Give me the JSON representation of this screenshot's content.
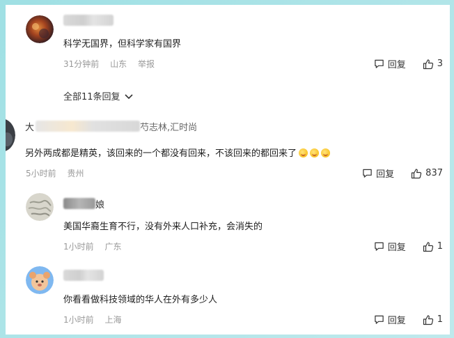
{
  "comments": [
    {
      "text": "科学无国界，但科学家有国界",
      "time": "31分钟前",
      "location": "山东",
      "report": "举报",
      "reply_label": "回复",
      "likes": "3"
    },
    {
      "username_visible": "芍志林,汇时尚",
      "text": "另外两成都是精英，该回来的一个都没有回来，不该回来的都回来了",
      "time": "5小时前",
      "location": "贵州",
      "reply_label": "回复",
      "likes": "837"
    },
    {
      "username_visible": "娘",
      "text": "美国华裔生育不行，没有外来人口补充，会消失的",
      "time": "1小时前",
      "location": "广东",
      "reply_label": "回复",
      "likes": "1"
    },
    {
      "text": "你看看做科技领域的华人在外有多少人",
      "time": "1小时前",
      "location": "上海",
      "reply_label": "回复",
      "likes": "1"
    }
  ],
  "expand_replies": "全部11条回复",
  "colors": {
    "accent": "#333333",
    "meta": "#999999",
    "background": "#ffffff"
  },
  "icons": {
    "reply": "speech-bubble-icon",
    "like": "thumbs-up-icon",
    "expand": "chevron-down-icon"
  }
}
